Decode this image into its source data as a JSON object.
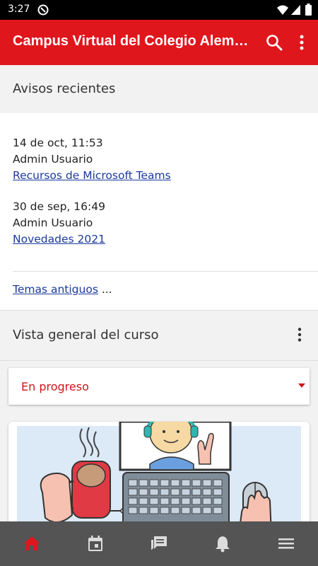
{
  "status_bar": {
    "time": "3:27"
  },
  "app_bar": {
    "title": "Campus Virtual del Colegio Alemán Valencia"
  },
  "recent_notices": {
    "heading": "Avisos recientes",
    "items": [
      {
        "date": "14 de oct, 11:53",
        "author": "Admin Usuario",
        "link": "Recursos de Microsoft Teams"
      },
      {
        "date": "30 de sep, 16:49",
        "author": "Admin Usuario",
        "link": "Novedades 2021"
      }
    ],
    "older_link": "Temas antiguos",
    "older_suffix": " ..."
  },
  "course_overview": {
    "heading": "Vista general del curso",
    "filter_value": "En progreso"
  },
  "bottom_nav": {
    "items": [
      "home-icon",
      "calendar-icon",
      "messages-icon",
      "notifications-icon",
      "menu-icon"
    ],
    "active": "home-icon"
  },
  "colors": {
    "primary": "#e0161d",
    "link": "#1a3a9c",
    "nav_bg": "#545454"
  }
}
